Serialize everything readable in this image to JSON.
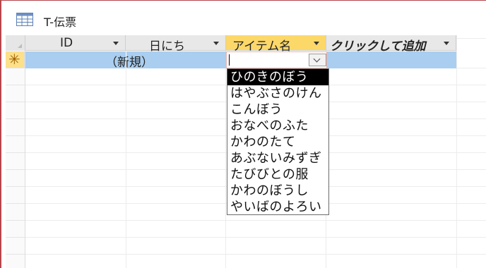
{
  "window": {
    "title": "T-伝票",
    "icon": "table-icon"
  },
  "columns": [
    {
      "label": "ID"
    },
    {
      "label": "日にち"
    },
    {
      "label": "アイテム名"
    },
    {
      "label": "クリックして追加"
    }
  ],
  "new_row": {
    "id_text": "（新規）",
    "marker": "✳"
  },
  "dropdown": {
    "selected_index": 0,
    "items": [
      "ひのきのぼう",
      "はやぶさのけん",
      "こんぼう",
      "おなべのふた",
      "かわのたて",
      "あぶないみずぎ",
      "たびびとの服",
      "かわのぼうし",
      "やいばのよろい"
    ]
  },
  "colors": {
    "accent_header": "#fcd869",
    "selected_row": "#a9cef0",
    "frame": "#b5474c"
  }
}
